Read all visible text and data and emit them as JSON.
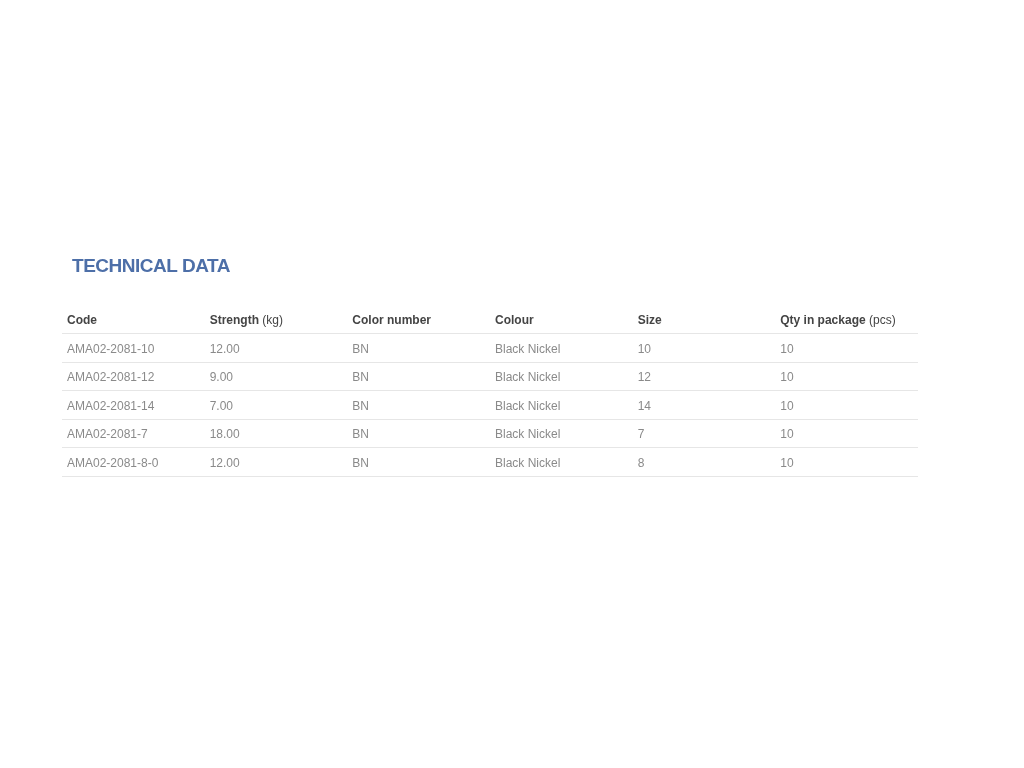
{
  "title": "TECHNICAL DATA",
  "table": {
    "columns": [
      "Code",
      "**Strength** (kg)",
      "Color number",
      "Colour",
      "Size",
      "**Qty in package** (pcs)"
    ],
    "rows": [
      [
        "AMA02-2081-10",
        "12.00",
        "BN",
        "Black Nickel",
        "10",
        "10"
      ],
      [
        "AMA02-2081-12",
        "9.00",
        "BN",
        "Black Nickel",
        "12",
        "10"
      ],
      [
        "AMA02-2081-14",
        "7.00",
        "BN",
        "Black Nickel",
        "14",
        "10"
      ],
      [
        "AMA02-2081-7",
        "18.00",
        "BN",
        "Black Nickel",
        "7",
        "10"
      ],
      [
        "AMA02-2081-8-0",
        "12.00",
        "BN",
        "Black Nickel",
        "8",
        "10"
      ]
    ]
  }
}
